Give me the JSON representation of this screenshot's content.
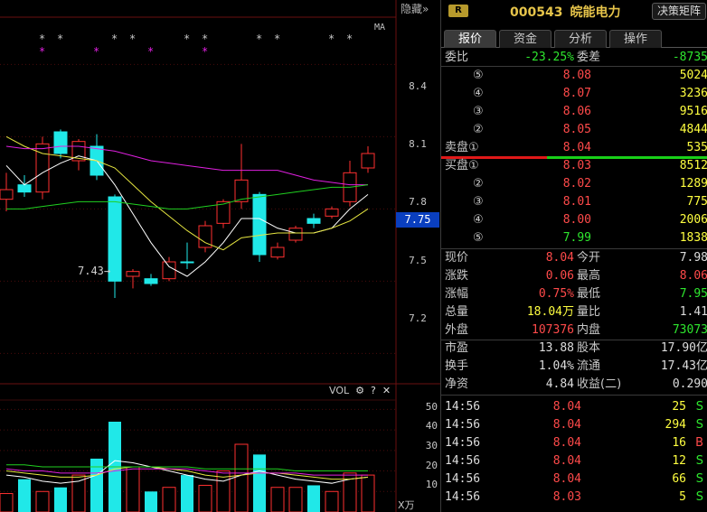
{
  "chart": {
    "hide_label": "隐藏",
    "hide_arrows": "»",
    "ma_label": "MA",
    "price_ticks": [
      "8.4",
      "8.1",
      "7.8",
      "7.5",
      "7.2"
    ],
    "current_price_tag": "7.75",
    "low_marker": "7.43→",
    "volume": {
      "label": "VOL",
      "ticks": [
        "50",
        "40",
        "30",
        "20",
        "10"
      ],
      "unit": "X万"
    }
  },
  "chart_data": {
    "type": "candlestick",
    "price_ylim": [
      7.1,
      8.6
    ],
    "candles": [
      {
        "o": 7.84,
        "c": 7.88,
        "h": 7.95,
        "l": 7.79,
        "up": true
      },
      {
        "o": 7.87,
        "c": 7.9,
        "h": 7.94,
        "l": 7.85,
        "up": false
      },
      {
        "o": 7.87,
        "c": 8.07,
        "h": 8.1,
        "l": 7.84,
        "up": true
      },
      {
        "o": 8.12,
        "c": 8.03,
        "h": 8.13,
        "l": 8.01,
        "up": false
      },
      {
        "o": 8.0,
        "c": 8.08,
        "h": 8.09,
        "l": 7.96,
        "up": true
      },
      {
        "o": 8.06,
        "c": 7.94,
        "h": 8.11,
        "l": 7.92,
        "up": false
      },
      {
        "o": 7.85,
        "c": 7.5,
        "h": 7.86,
        "l": 7.43,
        "up": false
      },
      {
        "o": 7.52,
        "c": 7.54,
        "h": 7.55,
        "l": 7.47,
        "up": true
      },
      {
        "o": 7.51,
        "c": 7.49,
        "h": 7.53,
        "l": 7.48,
        "up": false
      },
      {
        "o": 7.51,
        "c": 7.58,
        "h": 7.6,
        "l": 7.5,
        "up": true
      },
      {
        "o": 7.58,
        "c": 7.58,
        "h": 7.66,
        "l": 7.55,
        "up": false
      },
      {
        "o": 7.64,
        "c": 7.73,
        "h": 7.75,
        "l": 7.62,
        "up": true
      },
      {
        "o": 7.74,
        "c": 7.83,
        "h": 7.84,
        "l": 7.72,
        "up": true
      },
      {
        "o": 7.83,
        "c": 7.92,
        "h": 8.07,
        "l": 7.8,
        "up": true
      },
      {
        "o": 7.86,
        "c": 7.61,
        "h": 7.87,
        "l": 7.58,
        "up": false
      },
      {
        "o": 7.6,
        "c": 7.64,
        "h": 7.66,
        "l": 7.59,
        "up": true
      },
      {
        "o": 7.67,
        "c": 7.72,
        "h": 7.73,
        "l": 7.66,
        "up": true
      },
      {
        "o": 7.76,
        "c": 7.74,
        "h": 7.78,
        "l": 7.72,
        "up": false
      },
      {
        "o": 7.77,
        "c": 7.8,
        "h": 7.81,
        "l": 7.76,
        "up": true
      },
      {
        "o": 7.83,
        "c": 7.95,
        "h": 8.0,
        "l": 7.81,
        "up": true
      },
      {
        "o": 7.97,
        "c": 8.03,
        "h": 8.06,
        "l": 7.95,
        "up": true
      }
    ],
    "ma_series": [
      {
        "color": "#ffffff",
        "values": [
          7.98,
          7.9,
          7.95,
          7.99,
          8.02,
          8.0,
          7.9,
          7.78,
          7.66,
          7.56,
          7.52,
          7.58,
          7.66,
          7.76,
          7.76,
          7.72,
          7.7,
          7.7,
          7.72,
          7.8,
          7.86
        ]
      },
      {
        "color": "#e6e640",
        "values": [
          8.1,
          8.06,
          8.03,
          8.02,
          8.01,
          8.0,
          7.97,
          7.9,
          7.83,
          7.77,
          7.71,
          7.66,
          7.63,
          7.68,
          7.69,
          7.7,
          7.7,
          7.7,
          7.72,
          7.75,
          7.8
        ]
      },
      {
        "color": "#e020e0",
        "values": [
          8.06,
          8.05,
          8.05,
          8.06,
          8.06,
          8.05,
          8.04,
          8.02,
          8.0,
          7.99,
          7.98,
          7.97,
          7.96,
          7.96,
          7.96,
          7.96,
          7.94,
          7.92,
          7.91,
          7.9,
          7.9
        ]
      },
      {
        "color": "#20d020",
        "values": [
          7.8,
          7.8,
          7.81,
          7.82,
          7.83,
          7.83,
          7.83,
          7.82,
          7.81,
          7.8,
          7.8,
          7.81,
          7.82,
          7.84,
          7.85,
          7.86,
          7.87,
          7.88,
          7.89,
          7.89,
          7.9
        ]
      }
    ],
    "volume_ylim": [
      0,
      55
    ],
    "volumes": [
      9,
      16,
      10,
      12,
      18,
      26,
      44,
      22,
      10,
      12,
      18,
      13,
      20,
      33,
      28,
      12,
      12,
      13,
      10,
      19,
      18
    ],
    "volume_ma": [
      {
        "color": "#ffffff",
        "values": [
          18,
          17,
          15,
          14,
          15,
          18,
          25,
          24,
          22,
          20,
          18,
          16,
          15,
          18,
          20,
          18,
          16,
          15,
          14,
          16,
          17
        ]
      },
      {
        "color": "#e6e640",
        "values": [
          20,
          19,
          18,
          17,
          17,
          18,
          21,
          22,
          22,
          21,
          20,
          18,
          17,
          18,
          19,
          19,
          18,
          17,
          16,
          16,
          17
        ]
      },
      {
        "color": "#e020e0",
        "values": [
          21,
          20,
          20,
          19,
          19,
          19,
          20,
          21,
          21,
          21,
          21,
          20,
          19,
          19,
          19,
          19,
          19,
          18,
          18,
          18,
          18
        ]
      },
      {
        "color": "#20d020",
        "values": [
          23,
          23,
          22,
          22,
          22,
          22,
          22,
          22,
          22,
          22,
          22,
          21,
          21,
          21,
          21,
          21,
          20,
          20,
          20,
          20,
          20
        ]
      }
    ]
  },
  "quote": {
    "badge": "R",
    "code": "000543",
    "name": "皖能电力",
    "decision_btn": "决策矩阵",
    "tabs": [
      "报价",
      "资金",
      "分析",
      "操作"
    ],
    "wei_bi": {
      "label": "委比",
      "value": "-23.25%",
      "label2": "委差",
      "value2": "-8735"
    },
    "sell": [
      {
        "level": "⑤",
        "price": "8.08",
        "vol": "5024"
      },
      {
        "level": "④",
        "price": "8.07",
        "vol": "3236"
      },
      {
        "level": "③",
        "price": "8.06",
        "vol": "9516"
      },
      {
        "level": "②",
        "price": "8.05",
        "vol": "4844"
      },
      {
        "level": "卖盘①",
        "price": "8.04",
        "vol": "535"
      }
    ],
    "buy": [
      {
        "level": "买盘①",
        "price": "8.03",
        "vol": "8512"
      },
      {
        "level": "②",
        "price": "8.02",
        "vol": "1289"
      },
      {
        "level": "③",
        "price": "8.01",
        "vol": "775"
      },
      {
        "level": "④",
        "price": "8.00",
        "vol": "2006"
      },
      {
        "level": "⑤",
        "price": "7.99",
        "vol": "1838"
      }
    ],
    "stats": [
      {
        "l1": "现价",
        "v1": "8.04",
        "c1": "red",
        "l2": "今开",
        "v2": "7.98",
        "c2": "white"
      },
      {
        "l1": "涨跌",
        "v1": "0.06",
        "c1": "red",
        "l2": "最高",
        "v2": "8.06",
        "c2": "red"
      },
      {
        "l1": "涨幅",
        "v1": "0.75%",
        "c1": "red",
        "l2": "最低",
        "v2": "7.95",
        "c2": "green"
      },
      {
        "l1": "总量",
        "v1": "18.04万",
        "c1": "yellow",
        "l2": "量比",
        "v2": "1.41",
        "c2": "white"
      },
      {
        "l1": "外盘",
        "v1": "107376",
        "c1": "red",
        "l2": "内盘",
        "v2": "73073",
        "c2": "green"
      }
    ],
    "fundamentals": [
      {
        "l1": "市盈",
        "v1": "13.88",
        "l2": "股本",
        "v2": "17.90亿"
      },
      {
        "l1": "换手",
        "v1": "1.04%",
        "l2": "流通",
        "v2": "17.43亿"
      },
      {
        "l1": "净资",
        "v1": "4.84",
        "l2": "收益(二)",
        "v2": "0.290"
      }
    ],
    "ticks": [
      {
        "time": "14:56",
        "price": "8.04",
        "vol": "25",
        "side": "S"
      },
      {
        "time": "14:56",
        "price": "8.04",
        "vol": "294",
        "side": "S"
      },
      {
        "time": "14:56",
        "price": "8.04",
        "vol": "16",
        "side": "B"
      },
      {
        "time": "14:56",
        "price": "8.04",
        "vol": "12",
        "side": "S"
      },
      {
        "time": "14:56",
        "price": "8.04",
        "vol": "66",
        "side": "S"
      },
      {
        "time": "14:56",
        "price": "8.03",
        "vol": "5",
        "side": "S"
      }
    ]
  }
}
